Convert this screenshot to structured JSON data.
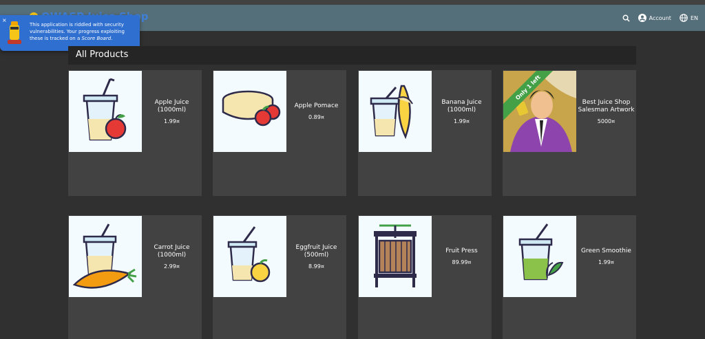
{
  "app": {
    "title": "OWASP Juice Shop"
  },
  "toolbar": {
    "account_label": "Account",
    "language_label": "EN"
  },
  "snackbar": {
    "text_main": "This application is riddled with security vulnerabilities. Your progress exploiting these is tracked on a ",
    "text_link": "Score Board",
    "text_end": ".",
    "close_label": "×"
  },
  "page": {
    "heading": "All Products"
  },
  "products": [
    {
      "name": "Apple Juice (1000ml)",
      "price": "1.99¤",
      "ribbon": ""
    },
    {
      "name": "Apple Pomace",
      "price": "0.89¤",
      "ribbon": ""
    },
    {
      "name": "Banana Juice (1000ml)",
      "price": "1.99¤",
      "ribbon": ""
    },
    {
      "name": "Best Juice Shop Salesman Artwork",
      "price": "5000¤",
      "ribbon": "Only 1 left"
    },
    {
      "name": "Carrot Juice (1000ml)",
      "price": "2.99¤",
      "ribbon": ""
    },
    {
      "name": "Eggfruit Juice (500ml)",
      "price": "8.99¤",
      "ribbon": ""
    },
    {
      "name": "Fruit Press",
      "price": "89.99¤",
      "ribbon": ""
    },
    {
      "name": "Green Smoothie",
      "price": "1.99¤",
      "ribbon": ""
    }
  ],
  "colors": {
    "toolbar": "#546e7a",
    "background": "#303030",
    "card": "#424242",
    "snackbar": "#2f6fd0",
    "ribbon": "#43a047"
  }
}
